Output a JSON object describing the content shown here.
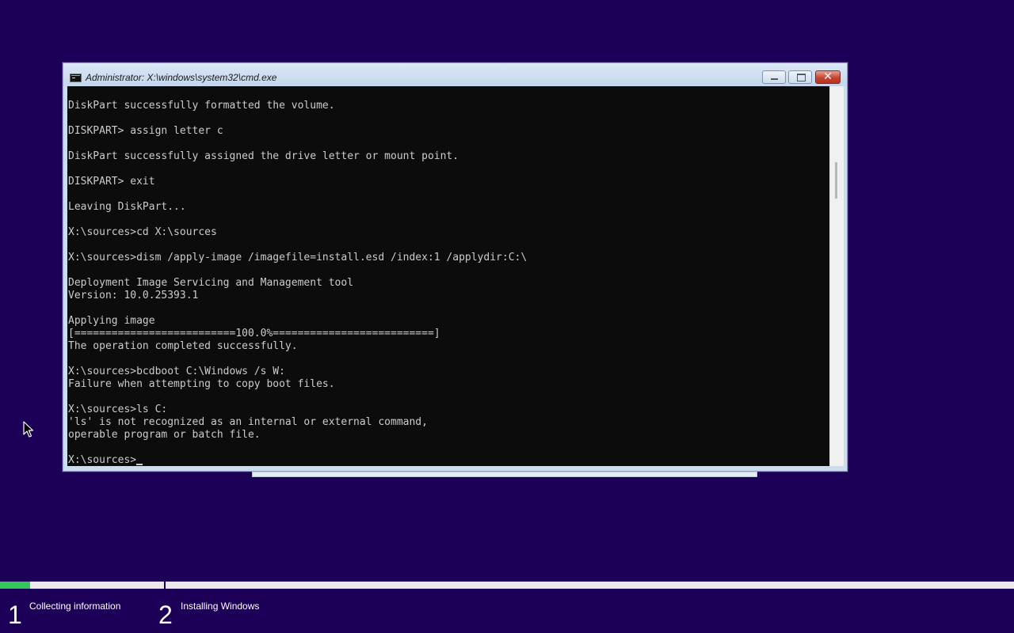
{
  "window": {
    "title": "Administrator: X:\\windows\\system32\\cmd.exe",
    "close_glyph": "✕"
  },
  "console": {
    "lines": [
      "DiskPart successfully formatted the volume.",
      "",
      "DISKPART> assign letter c",
      "",
      "DiskPart successfully assigned the drive letter or mount point.",
      "",
      "DISKPART> exit",
      "",
      "Leaving DiskPart...",
      "",
      "X:\\sources>cd X:\\sources",
      "",
      "X:\\sources>dism /apply-image /imagefile=install.esd /index:1 /applydir:C:\\",
      "",
      "Deployment Image Servicing and Management tool",
      "Version: 10.0.25393.1",
      "",
      "Applying image",
      "[==========================100.0%==========================]",
      "The operation completed successfully.",
      "",
      "X:\\sources>bcdboot C:\\Windows /s W:",
      "Failure when attempting to copy boot files.",
      "",
      "X:\\sources>ls C:",
      "'ls' is not recognized as an internal or external command,",
      "operable program or batch file.",
      ""
    ],
    "prompt": "X:\\sources>"
  },
  "setup": {
    "progress_fraction": 0.03,
    "steps": [
      {
        "number": "1",
        "label": "Collecting information"
      },
      {
        "number": "2",
        "label": "Installing Windows"
      }
    ]
  },
  "colors": {
    "background": "#1c0057",
    "console_bg": "#0c0c0c",
    "console_fg": "#cccccc",
    "progress": "#34c759"
  }
}
